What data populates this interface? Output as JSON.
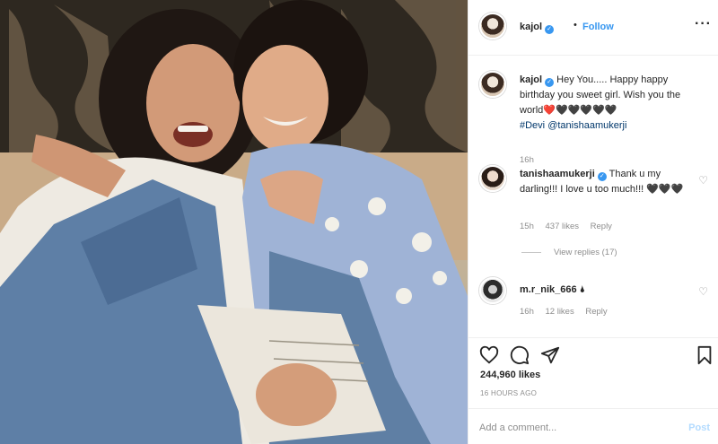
{
  "post_header": {
    "username": "kajol",
    "separator": "•",
    "follow_label": "Follow",
    "more_label": "···"
  },
  "comments": [
    {
      "username": "kajol",
      "text": "Hey You..... Happy happy birthday you sweet girl. Wish you the world❤️🖤🖤🖤🖤🖤",
      "hashtag": "#Devi",
      "mention": "@tanishaamukerji",
      "time": "16h"
    },
    {
      "username": "tanishaamukerji",
      "text": "Thank u my darling!!! I love u too much!!! 🖤🖤🖤",
      "time": "15h",
      "likes": "437 likes",
      "reply_label": "Reply",
      "view_replies": "View replies (17)"
    },
    {
      "username": "m.r_nik_666",
      "text": "🌢",
      "time": "16h",
      "likes": "12 likes",
      "reply_label": "Reply"
    }
  ],
  "likes_count": "244,960 likes",
  "time_ago": "16 HOURS AGO",
  "add_comment": {
    "placeholder": "Add a comment...",
    "post_label": "Post"
  },
  "icons": [
    "heart-icon",
    "comment-icon",
    "share-icon",
    "bookmark-icon",
    "verified-badge-icon",
    "more-options-icon"
  ],
  "colors": {
    "link_blue": "#3897f0",
    "text": "#262626",
    "muted": "#8e8e8e",
    "post_disabled": "#b3dbff"
  }
}
